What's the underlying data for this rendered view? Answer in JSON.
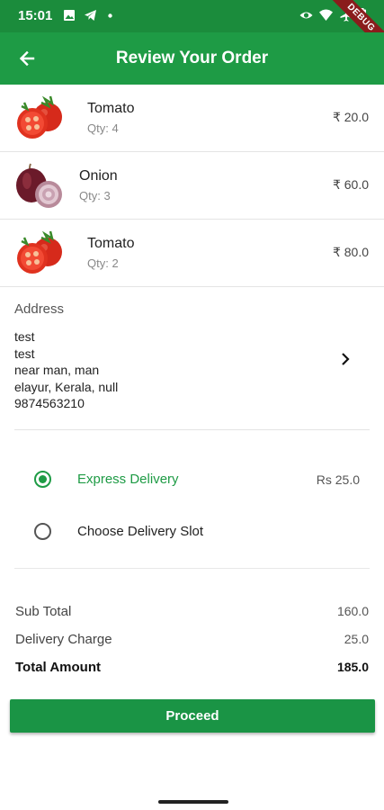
{
  "status_bar": {
    "time": "15:01",
    "left_icons": [
      "image-icon",
      "telegram-icon",
      "dot-icon"
    ],
    "right_icons": [
      "eye-icon",
      "wifi-icon",
      "airplane-icon",
      "battery-icon"
    ],
    "debug_ribbon": "DEBUG"
  },
  "app_bar": {
    "title": "Review Your Order",
    "back_icon": "arrow-left-icon",
    "color": "#1e9b45"
  },
  "items": [
    {
      "name": "Tomato",
      "qty": "Qty: 4",
      "price": "₹ 20.0",
      "image": "tomato"
    },
    {
      "name": "Onion",
      "qty": "Qty: 3",
      "price": "₹ 60.0",
      "image": "onion"
    },
    {
      "name": "Tomato",
      "qty": "Qty: 2",
      "price": "₹ 80.0",
      "image": "tomato"
    }
  ],
  "address": {
    "label": "Address",
    "lines": [
      "test",
      "test",
      "near man, man",
      "elayur, Kerala, null",
      "9874563210"
    ],
    "chevron_icon": "chevron-right-icon"
  },
  "delivery": {
    "options": [
      {
        "label": "Express Delivery",
        "price": "Rs 25.0",
        "selected": true
      },
      {
        "label": "Choose Delivery Slot",
        "price": "",
        "selected": false
      }
    ]
  },
  "summary": {
    "sub_total_label": "Sub Total",
    "sub_total_value": "160.0",
    "delivery_charge_label": "Delivery Charge",
    "delivery_charge_value": "25.0",
    "total_label": "Total Amount",
    "total_value": "185.0"
  },
  "proceed_label": "Proceed",
  "colors": {
    "primary": "#1e9b45",
    "status_bar": "#1b8c3c"
  }
}
